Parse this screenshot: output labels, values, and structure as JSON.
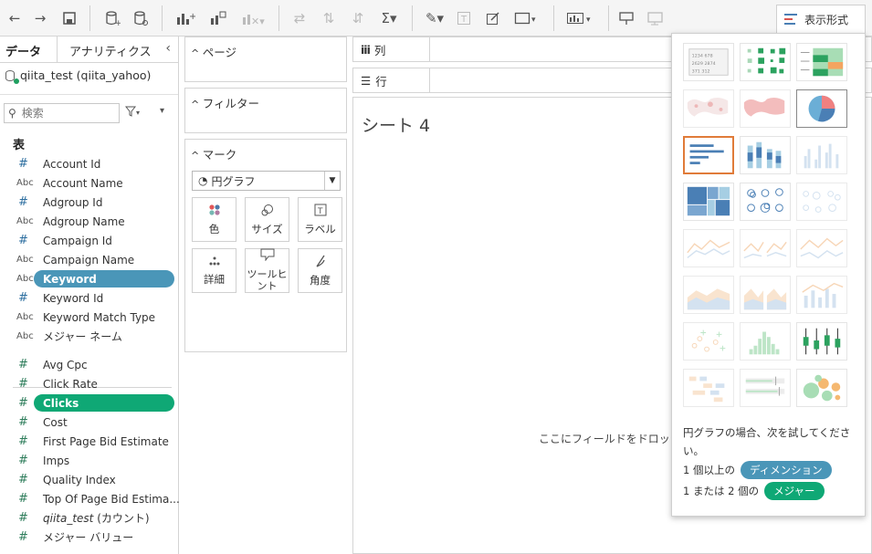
{
  "toolbar": {
    "icons": [
      "undo-icon",
      "redo-icon",
      "save-icon",
      "new-datasource-icon",
      "datasource-icon",
      "new-worksheet-icon",
      "duplicate-icon",
      "clear-icon",
      "swap-icon",
      "sort-asc-icon",
      "sort-desc-icon",
      "totals-icon",
      "highlight-icon",
      "text-label-icon",
      "fix-axes-icon",
      "fit-icon",
      "show-cards-icon",
      "presentation-icon",
      "device-icon"
    ],
    "show_me_label": "表示形式"
  },
  "data_pane": {
    "tab_data": "データ",
    "tab_analytics": "アナリティクス",
    "collapse": "‹",
    "datasource": "qiita_test (qiita_yahoo)",
    "search_placeholder": "検索",
    "tables_header": "表",
    "dimensions": [
      {
        "type": "#",
        "name": "Account Id"
      },
      {
        "type": "Abc",
        "name": "Account Name"
      },
      {
        "type": "#",
        "name": "Adgroup Id"
      },
      {
        "type": "Abc",
        "name": "Adgroup Name"
      },
      {
        "type": "#",
        "name": "Campaign Id"
      },
      {
        "type": "Abc",
        "name": "Campaign Name"
      },
      {
        "type": "Abc",
        "name": "Keyword"
      },
      {
        "type": "#",
        "name": "Keyword Id"
      },
      {
        "type": "Abc",
        "name": "Keyword Match Type"
      },
      {
        "type": "Abc",
        "name": "メジャー ネーム"
      }
    ],
    "measures": [
      {
        "type": "#",
        "name": "Avg Cpc"
      },
      {
        "type": "#",
        "name": "Click Rate"
      },
      {
        "type": "#",
        "name": "Clicks"
      },
      {
        "type": "#",
        "name": "Cost"
      },
      {
        "type": "#",
        "name": "First Page Bid Estimate"
      },
      {
        "type": "#",
        "name": "Imps"
      },
      {
        "type": "#",
        "name": "Quality Index"
      },
      {
        "type": "#",
        "name": "Top Of Page Bid Estima..."
      },
      {
        "type": "#",
        "name": "qiita_test",
        "suffix": " (カウント)"
      },
      {
        "type": "#",
        "name": "メジャー バリュー"
      }
    ],
    "colors": {
      "dimension_pill": "#4a96b8",
      "measure_pill": "#0fa875"
    }
  },
  "cards": {
    "pages": "ページ",
    "filters": "フィルター",
    "marks": "マーク",
    "mark_type": "円グラフ",
    "buttons": [
      {
        "label": "色",
        "icon": "color-icon"
      },
      {
        "label": "サイズ",
        "icon": "size-icon"
      },
      {
        "label": "ラベル",
        "icon": "label-icon"
      },
      {
        "label": "詳細",
        "icon": "detail-icon"
      },
      {
        "label": "ツールヒント",
        "icon": "tooltip-icon"
      },
      {
        "label": "角度",
        "icon": "angle-icon"
      }
    ]
  },
  "shelves": {
    "columns": "列",
    "rows": "行"
  },
  "sheet": {
    "title": "シート 4",
    "drop_hint": "ここにフィールドをドロッ"
  },
  "show_me": {
    "hint": "円グラフの場合、次を試してください。",
    "req1_prefix": "1 個以上の",
    "req1_pill": "ディメンション",
    "req2_prefix": "1 または 2 個の",
    "req2_pill": "メジャー"
  }
}
